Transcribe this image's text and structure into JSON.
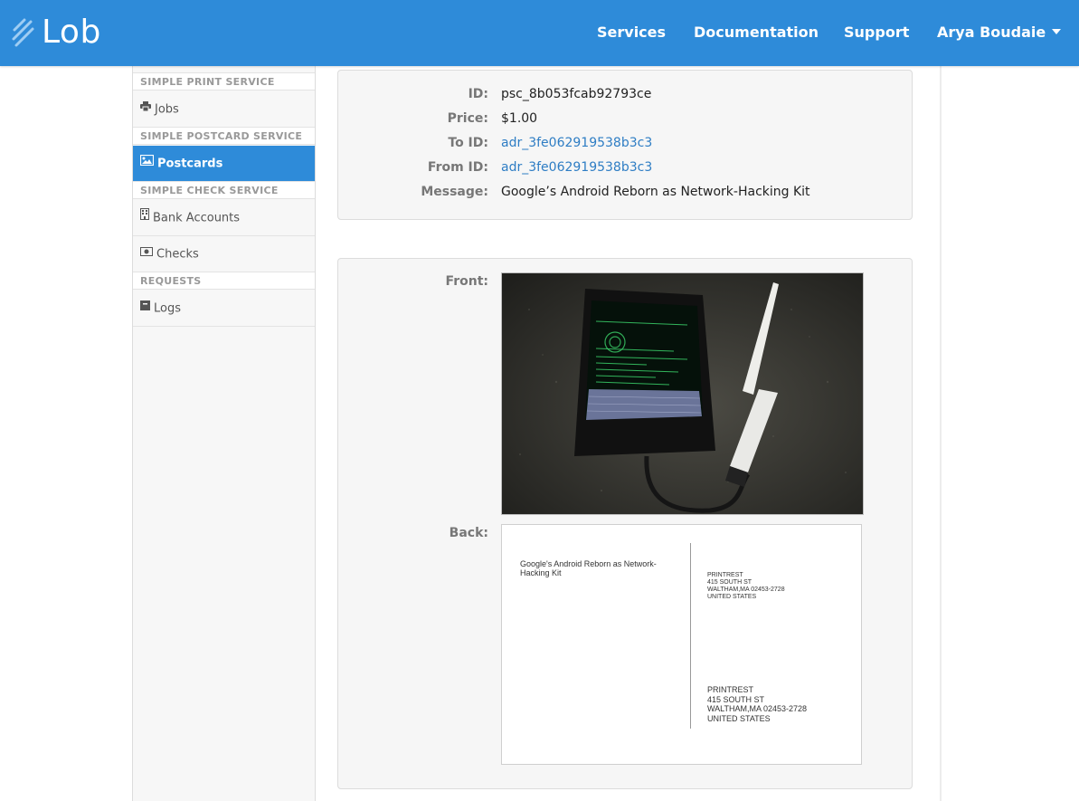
{
  "nav": {
    "brand": "Lob",
    "links": [
      "Services",
      "Documentation",
      "Support"
    ],
    "user": "Arya Boudaie"
  },
  "sidebar": {
    "sections": [
      {
        "heading": "SIMPLE PRINT SERVICE",
        "items": [
          {
            "label": "Jobs",
            "icon": "printer-icon"
          }
        ]
      },
      {
        "heading": "SIMPLE POSTCARD SERVICE",
        "items": [
          {
            "label": "Postcards",
            "icon": "image-icon",
            "active": true
          }
        ]
      },
      {
        "heading": "SIMPLE CHECK SERVICE",
        "items": [
          {
            "label": "Bank Accounts",
            "icon": "building-icon"
          },
          {
            "label": "Checks",
            "icon": "money-icon"
          }
        ]
      },
      {
        "heading": "REQUESTS",
        "items": [
          {
            "label": "Logs",
            "icon": "log-icon"
          }
        ]
      }
    ]
  },
  "details": {
    "id_label": "ID:",
    "id": "psc_8b053fcab92793ce",
    "price_label": "Price:",
    "price": "$1.00",
    "to_label": "To ID:",
    "to_id": "adr_3fe062919538b3c3",
    "from_label": "From ID:",
    "from_id": "adr_3fe062919538b3c3",
    "message_label": "Message:",
    "message": "Google’s Android Reborn as Network-Hacking Kit"
  },
  "preview": {
    "front_label": "Front:",
    "back_label": "Back:",
    "back_message": "Google's Android Reborn as Network-Hacking Kit",
    "from_address": [
      "PRINTREST",
      "415 SOUTH ST",
      "WALTHAM,MA 02453-2728",
      "UNITED STATES"
    ],
    "to_address": [
      "PRINTREST",
      "415 SOUTH ST",
      "WALTHAM,MA 02453-2728",
      "UNITED STATES"
    ]
  },
  "colors": {
    "brand_blue": "#2e8bd9",
    "link_blue": "#2e7dc4"
  }
}
